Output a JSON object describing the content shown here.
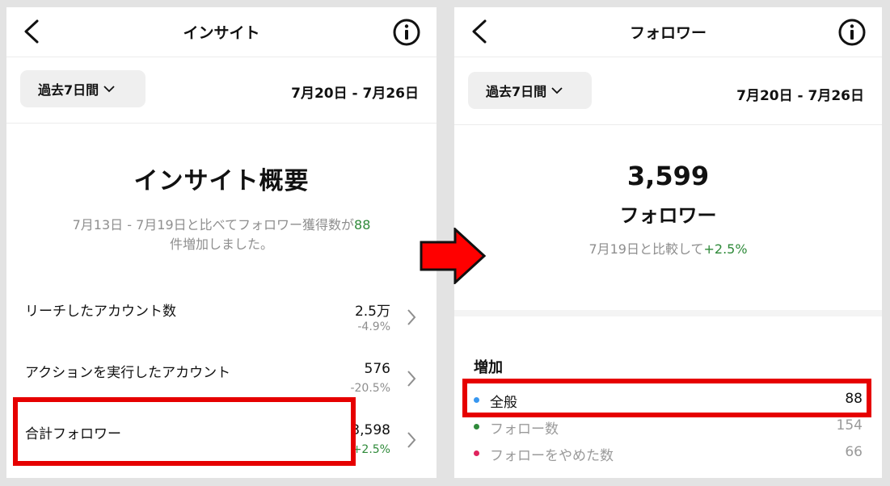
{
  "left": {
    "header": {
      "title": "インサイト"
    },
    "range_button": {
      "label": "過去7日間"
    },
    "date_range": "7月20日 - 7月26日",
    "overview": {
      "title": "インサイト概要",
      "summary_prefix": "7月13日 - 7月19日と比べてフォロワー獲得数が",
      "summary_count": "88",
      "summary_suffix": "件増加しました。"
    },
    "metrics": [
      {
        "label": "リーチしたアカウント数",
        "value": "2.5万",
        "change": "-4.9%"
      },
      {
        "label": "アクションを実行したアカウント",
        "value": "576",
        "change": "-20.5%"
      },
      {
        "label": "合計フォロワー",
        "value": "3,598",
        "change": "+2.5%"
      }
    ]
  },
  "right": {
    "header": {
      "title": "フォロワー"
    },
    "range_button": {
      "label": "過去7日間"
    },
    "date_range": "7月20日 - 7月26日",
    "followers": {
      "count": "3,599",
      "label": "フォロワー",
      "compare_prefix": "7月19日と比較して",
      "compare_change": "+2.5%"
    },
    "growth": {
      "title": "増加",
      "items": [
        {
          "label": "全般",
          "value": "88",
          "dot_color": "#3897f0"
        },
        {
          "label": "フォロー数",
          "value": "154",
          "dot_color": "#2f8a3a"
        },
        {
          "label": "フォローをやめた数",
          "value": "66",
          "dot_color": "#e0245e"
        }
      ]
    }
  },
  "colors": {
    "highlight": "#e60000",
    "positive": "#2f8a3a",
    "arrow_fill": "#ff0000"
  },
  "icons": {
    "back": "chevron-left-icon",
    "info": "info-circle-icon",
    "dropdown": "chevron-down-icon",
    "row": "chevron-right-icon",
    "arrow": "right-arrow-icon"
  }
}
